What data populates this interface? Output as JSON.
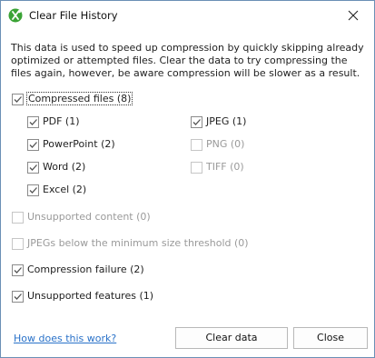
{
  "window": {
    "title": "Clear File History"
  },
  "description": "This data is used to speed up compression by quickly skipping already optimized or attempted files. Clear the data to try compressing the files again, however, be aware compression will be slower as a result.",
  "compressed_files": {
    "label": "Compressed files (8)",
    "checked": true
  },
  "file_types_left": [
    {
      "label": "PDF (1)",
      "checked": true,
      "enabled": true
    },
    {
      "label": "PowerPoint (2)",
      "checked": true,
      "enabled": true
    },
    {
      "label": "Word (2)",
      "checked": true,
      "enabled": true
    },
    {
      "label": "Excel (2)",
      "checked": true,
      "enabled": true
    }
  ],
  "file_types_right": [
    {
      "label": "JPEG (1)",
      "checked": true,
      "enabled": true
    },
    {
      "label": "PNG (0)",
      "checked": false,
      "enabled": false
    },
    {
      "label": "TIFF (0)",
      "checked": false,
      "enabled": false
    }
  ],
  "other_options": [
    {
      "label": "Unsupported content (0)",
      "checked": false,
      "enabled": false
    },
    {
      "label": "JPEGs below the minimum size threshold (0)",
      "checked": false,
      "enabled": false
    },
    {
      "label": "Compression failure (2)",
      "checked": true,
      "enabled": true
    },
    {
      "label": "Unsupported features (1)",
      "checked": true,
      "enabled": true
    }
  ],
  "footer": {
    "help_link": "How does this work?",
    "clear_button": "Clear data",
    "close_button": "Close"
  },
  "colors": {
    "link": "#2a72c9",
    "app_icon": "#3aa335",
    "border": "#6b8fb5"
  }
}
